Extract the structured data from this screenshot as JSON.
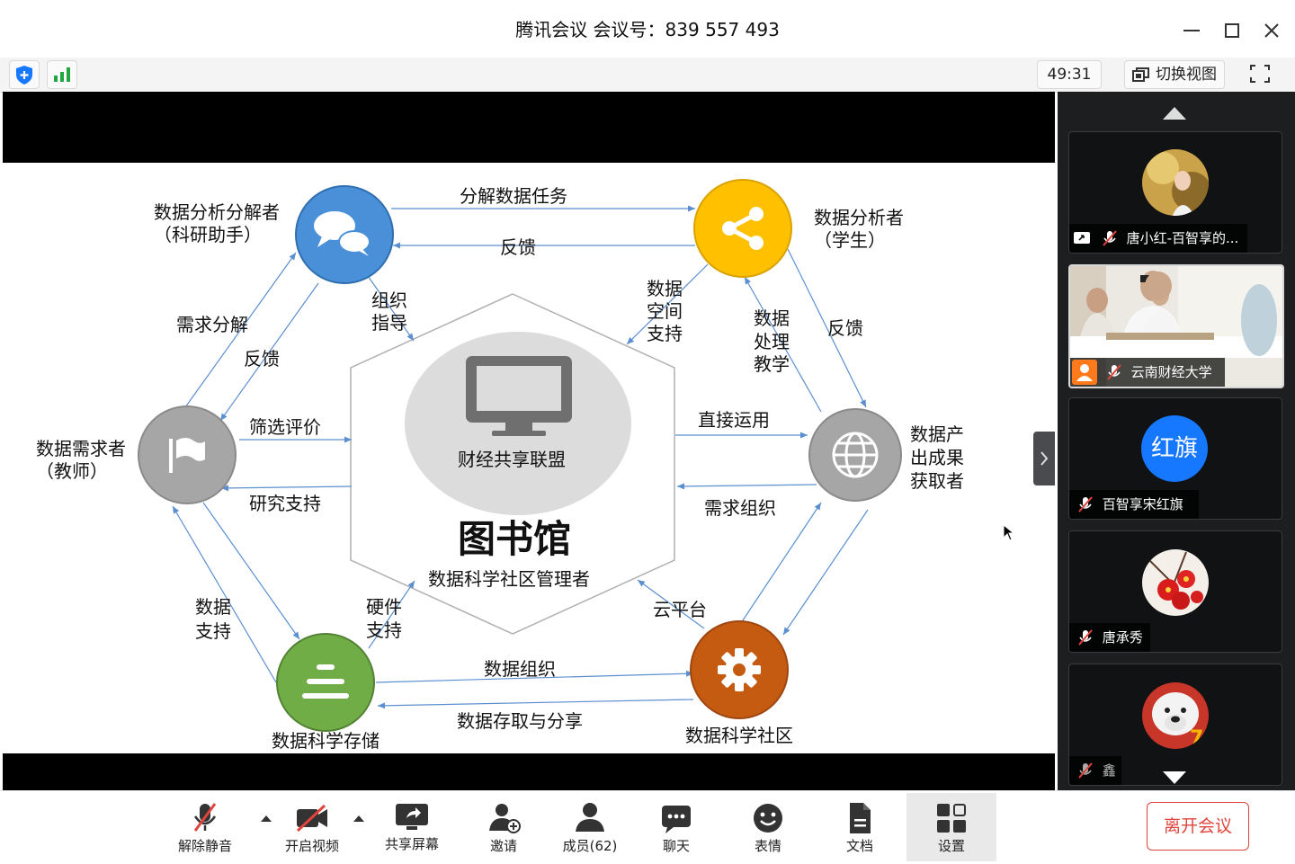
{
  "window": {
    "title": "腾讯会议 会议号：839 557 493"
  },
  "status_bar": {
    "timer": "49:31",
    "switch_view_label": "切换视图"
  },
  "slide": {
    "hub_title": "图书馆",
    "hub_subtitle": "数据科学社区管理者",
    "hub_inner_label": "财经共享联盟",
    "nodes": {
      "analyst_decomposer": {
        "line1": "数据分析分解者",
        "line2": "（科研助手）"
      },
      "analyst": {
        "line1": "数据分析者",
        "line2": "（学生）"
      },
      "demander": {
        "line1": "数据需求者",
        "line2": "（教师）"
      },
      "producer": {
        "line1": "数据产",
        "line2": "出成果",
        "line3": "获取者"
      },
      "storage": {
        "label": "数据科学存储"
      },
      "community": {
        "label": "数据科学社区"
      }
    },
    "edges": {
      "decompose_task": "分解数据任务",
      "feedback_top": "反馈",
      "org_guide": {
        "line1": "组织",
        "line2": "指导"
      },
      "space_support": {
        "line1": "数据",
        "line2": "空间",
        "line3": "支持"
      },
      "process_teach": {
        "line1": "数据",
        "line2": "处理",
        "line3": "教学"
      },
      "feedback_right": "反馈",
      "demand_decompose": "需求分解",
      "feedback_left": "反馈",
      "screen_eval": "筛选评价",
      "research_support": "研究支持",
      "direct_use": "直接运用",
      "demand_org": "需求组织",
      "data_support": {
        "line1": "数据",
        "line2": "支持"
      },
      "hardware_support": {
        "line1": "硬件",
        "line2": "支持"
      },
      "cloud_platform": "云平台",
      "data_org": "数据组织",
      "data_access_share": "数据存取与分享"
    }
  },
  "participants": [
    {
      "name": "唐小红-百智享的...",
      "icon": "avatar-photo"
    },
    {
      "name": "云南财经大学",
      "icon": "video-feed"
    },
    {
      "name": "百智享宋红旗",
      "avatar_text": "红旗",
      "avatar_color": "#1677ff"
    },
    {
      "name": "唐承秀",
      "icon": "avatar-flowers"
    },
    {
      "name": "鑫",
      "icon": "avatar-bear"
    }
  ],
  "toolbar": {
    "unmute": "解除静音",
    "start_video": "开启视频",
    "share_screen": "共享屏幕",
    "invite": "邀请",
    "members": "成员(62)",
    "chat": "聊天",
    "emoji": "表情",
    "docs": "文档",
    "settings": "设置",
    "leave": "离开会议"
  },
  "colors": {
    "node_blue": "#4a90d9",
    "node_yellow": "#ffc000",
    "node_gray": "#a6a6a6",
    "node_green": "#70ad47",
    "node_orange": "#c55a11",
    "leave_red": "#e0443c",
    "arrow": "#5b8fd0"
  }
}
